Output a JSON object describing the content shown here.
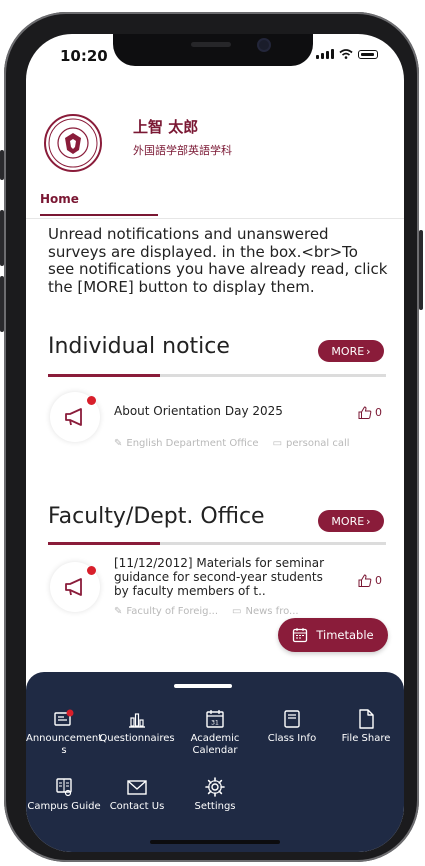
{
  "status_bar": {
    "time": "10:20"
  },
  "profile": {
    "name": "上智 太郎",
    "department": "外国語学部英語学科"
  },
  "tabs": [
    {
      "label": "Home"
    }
  ],
  "intro_text": "Unread notifications and unanswered surveys are displayed. in the box.<br>To see notifications you have already read, click the [MORE] button to display them.",
  "sections": {
    "individual": {
      "title": "Individual notice",
      "more_label": "MORE",
      "progress": 0.33,
      "notice": {
        "title": "About Orientation Day 2025",
        "likes": "0",
        "sender": "English Department Office",
        "category": "personal call"
      }
    },
    "faculty": {
      "title": "Faculty/Dept. Office",
      "more_label": "MORE",
      "progress": 0.33,
      "notice": {
        "title": "[11/12/2012] Materials for seminar guidance for second-year students by faculty members of t..",
        "likes": "0",
        "sender": "Faculty of Foreig...",
        "category": "News fro..."
      }
    }
  },
  "timetable_button": {
    "label": "Timetable"
  },
  "bottom_nav": {
    "items": [
      {
        "label": "Announcement s",
        "icon": "announcement-icon"
      },
      {
        "label": "Questionnaires",
        "icon": "chart-icon"
      },
      {
        "label": "Academic Calendar",
        "icon": "calendar-icon"
      },
      {
        "label": "Class Info",
        "icon": "book-icon"
      },
      {
        "label": "File Share",
        "icon": "file-icon"
      },
      {
        "label": "Campus Guide",
        "icon": "guide-icon"
      },
      {
        "label": "Contact Us",
        "icon": "mail-icon"
      },
      {
        "label": "Settings",
        "icon": "gear-icon"
      }
    ]
  },
  "colors": {
    "brand": "#8a1c3a",
    "nav_bg": "#1f2a44",
    "badge": "#d81e2a"
  }
}
